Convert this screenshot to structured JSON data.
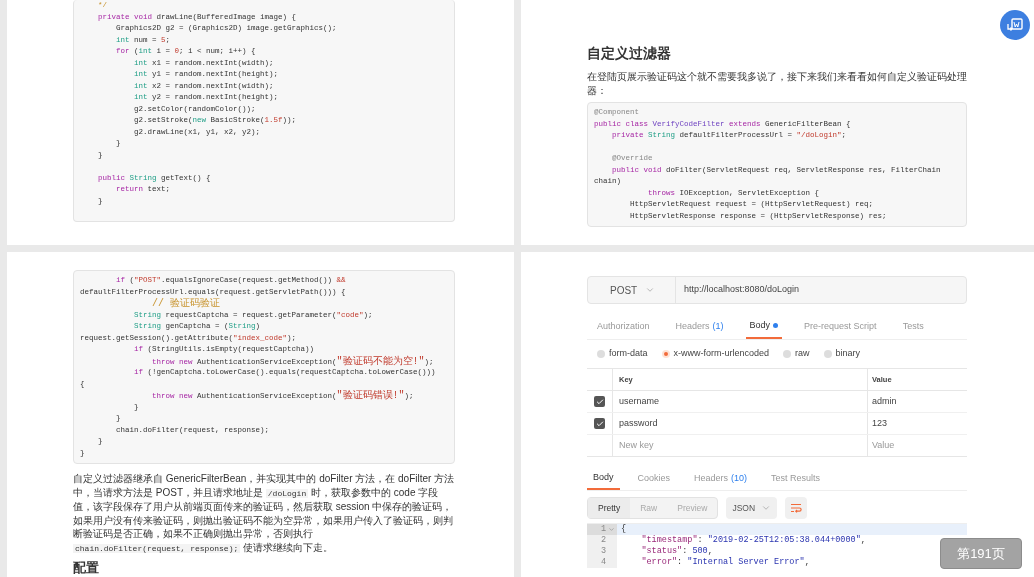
{
  "top_left_page": {
    "code": [
      {
        "kind": "code",
        "tokens": [
          {
            "text": "    */",
            "kind": "cm"
          }
        ]
      },
      {
        "kind": "code",
        "tokens": [
          {
            "text": "    private void",
            "kind": "kw"
          },
          {
            "text": " drawLine(BufferedImage image) {",
            "kind": "plain"
          }
        ]
      },
      {
        "kind": "code",
        "tokens": [
          {
            "text": "        Graphics2D g2 = (Graphics2D) image.getGraphics();",
            "kind": "plain"
          }
        ]
      },
      {
        "kind": "code",
        "tokens": [
          {
            "text": "        int",
            "kind": "ty"
          },
          {
            "text": " num = ",
            "kind": "plain"
          },
          {
            "text": "5",
            "kind": "num"
          },
          {
            "text": ";",
            "kind": "plain"
          }
        ]
      },
      {
        "kind": "code",
        "tokens": [
          {
            "text": "        for",
            "kind": "kw"
          },
          {
            "text": " (",
            "kind": "plain"
          },
          {
            "text": "int",
            "kind": "ty"
          },
          {
            "text": " i = ",
            "kind": "plain"
          },
          {
            "text": "0",
            "kind": "num"
          },
          {
            "text": "; i < num; i++) {",
            "kind": "plain"
          }
        ]
      },
      {
        "kind": "code",
        "tokens": [
          {
            "text": "            int",
            "kind": "ty"
          },
          {
            "text": " x1 = random.nextInt(width);",
            "kind": "plain"
          }
        ]
      },
      {
        "kind": "code",
        "tokens": [
          {
            "text": "            int",
            "kind": "ty"
          },
          {
            "text": " y1 = random.nextInt(height);",
            "kind": "plain"
          }
        ]
      },
      {
        "kind": "code",
        "tokens": [
          {
            "text": "            int",
            "kind": "ty"
          },
          {
            "text": " x2 = random.nextInt(width);",
            "kind": "plain"
          }
        ]
      },
      {
        "kind": "code",
        "tokens": [
          {
            "text": "            int",
            "kind": "ty"
          },
          {
            "text": " y2 = random.nextInt(height);",
            "kind": "plain"
          }
        ]
      },
      {
        "kind": "code",
        "tokens": [
          {
            "text": "            g2.setColor(randomColor());",
            "kind": "plain"
          }
        ]
      },
      {
        "kind": "code",
        "tokens": [
          {
            "text": "            g2.setStroke(",
            "kind": "plain"
          },
          {
            "text": "new",
            "kind": "ty"
          },
          {
            "text": " BasicStroke(",
            "kind": "plain"
          },
          {
            "text": "1.5f",
            "kind": "num"
          },
          {
            "text": "));",
            "kind": "plain"
          }
        ]
      },
      {
        "kind": "code",
        "tokens": [
          {
            "text": "            g2.drawLine(x1, y1, x2, y2);",
            "kind": "plain"
          }
        ]
      },
      {
        "kind": "code",
        "tokens": [
          {
            "text": "        }",
            "kind": "plain"
          }
        ]
      },
      {
        "kind": "code",
        "tokens": [
          {
            "text": "    }",
            "kind": "plain"
          }
        ]
      },
      {
        "kind": "blank"
      },
      {
        "kind": "code",
        "tokens": [
          {
            "text": "    public",
            "kind": "kw"
          },
          {
            "text": " String",
            "kind": "ty"
          },
          {
            "text": " getText() {",
            "kind": "plain"
          }
        ]
      },
      {
        "kind": "code",
        "tokens": [
          {
            "text": "        return",
            "kind": "kw"
          },
          {
            "text": " text;",
            "kind": "plain"
          }
        ]
      },
      {
        "kind": "code",
        "tokens": [
          {
            "text": "    }",
            "kind": "plain"
          }
        ]
      }
    ]
  },
  "top_right_page": {
    "heading": "自定义过滤器",
    "intro": "在登陆页展示验证码这个就不需要我多说了，接下来我们来看看如何自定义验证码处理器：",
    "code": [
      {
        "kind": "code",
        "tokens": [
          {
            "text": "@Component",
            "kind": "an"
          }
        ]
      },
      {
        "kind": "code",
        "tokens": [
          {
            "text": "public class",
            "kind": "kw"
          },
          {
            "text": " VerifyCodeFilter",
            "kind": "cls"
          },
          {
            "text": " extends",
            "kind": "kw"
          },
          {
            "text": " GenericFilterBean {",
            "kind": "plain"
          }
        ]
      },
      {
        "kind": "code",
        "tokens": [
          {
            "text": "    private",
            "kind": "kw"
          },
          {
            "text": " String",
            "kind": "ty"
          },
          {
            "text": " defaultFilterProcessUrl = ",
            "kind": "plain"
          },
          {
            "text": "\"/doLogin\"",
            "kind": "str"
          },
          {
            "text": ";",
            "kind": "plain"
          }
        ]
      },
      {
        "kind": "blank"
      },
      {
        "kind": "code",
        "tokens": [
          {
            "text": "    @Override",
            "kind": "an"
          }
        ]
      },
      {
        "kind": "code",
        "tokens": [
          {
            "text": "    public void",
            "kind": "kw"
          },
          {
            "text": " doFilter(ServletRequest req, ServletResponse res, FilterChain",
            "kind": "plain"
          }
        ]
      },
      {
        "kind": "code",
        "tokens": [
          {
            "text": "chain)",
            "kind": "plain"
          }
        ]
      },
      {
        "kind": "code",
        "tokens": [
          {
            "text": "            throws",
            "kind": "kw"
          },
          {
            "text": " IOException, ServletException {",
            "kind": "plain"
          }
        ]
      },
      {
        "kind": "code",
        "tokens": [
          {
            "text": "        HttpServletRequest request = (HttpServletRequest) req;",
            "kind": "plain"
          }
        ]
      },
      {
        "kind": "code",
        "tokens": [
          {
            "text": "        HttpServletResponse response = (HttpServletResponse) res;",
            "kind": "plain"
          }
        ]
      }
    ]
  },
  "bottom_left_page": {
    "code": [
      {
        "kind": "code",
        "tokens": [
          {
            "text": "        if",
            "kind": "kw"
          },
          {
            "text": " (",
            "kind": "plain"
          },
          {
            "text": "\"POST\"",
            "kind": "str"
          },
          {
            "text": ".equalsIgnoreCase(request.getMethod()) ",
            "kind": "plain"
          },
          {
            "text": "&&",
            "kind": "str"
          }
        ]
      },
      {
        "kind": "code",
        "tokens": [
          {
            "text": "defaultFilterProcessUrl.equals(request.getServletPath())) {",
            "kind": "plain"
          }
        ]
      },
      {
        "kind": "code",
        "tokens": [
          {
            "text": "            // 验证码验证",
            "kind": "cmzh"
          }
        ]
      },
      {
        "kind": "code",
        "tokens": [
          {
            "text": "            String",
            "kind": "ty"
          },
          {
            "text": " requestCaptcha = request.getParameter(",
            "kind": "plain"
          },
          {
            "text": "\"code\"",
            "kind": "str"
          },
          {
            "text": ");",
            "kind": "plain"
          }
        ]
      },
      {
        "kind": "code",
        "tokens": [
          {
            "text": "            String",
            "kind": "ty"
          },
          {
            "text": " genCaptcha = (",
            "kind": "plain"
          },
          {
            "text": "String",
            "kind": "ty"
          },
          {
            "text": ")",
            "kind": "plain"
          }
        ]
      },
      {
        "kind": "code",
        "tokens": [
          {
            "text": "request.getSession().getAttribute(",
            "kind": "plain"
          },
          {
            "text": "\"index_code\"",
            "kind": "str"
          },
          {
            "text": ");",
            "kind": "plain"
          }
        ]
      },
      {
        "kind": "code",
        "tokens": [
          {
            "text": "            if",
            "kind": "kw"
          },
          {
            "text": " (StringUtils.isEmpty(requestCaptcha))",
            "kind": "plain"
          }
        ]
      },
      {
        "kind": "code",
        "tokens": [
          {
            "text": "                throw new",
            "kind": "kw"
          },
          {
            "text": " AuthenticationServiceException(",
            "kind": "plain"
          },
          {
            "text": "\"验证码不能为空!\"",
            "kind": "strzh"
          },
          {
            "text": ");",
            "kind": "plain"
          }
        ]
      },
      {
        "kind": "code",
        "tokens": [
          {
            "text": "            if",
            "kind": "kw"
          },
          {
            "text": " (!genCaptcha.toLowerCase().equals(requestCaptcha.toLowerCase()))",
            "kind": "plain"
          }
        ]
      },
      {
        "kind": "code",
        "tokens": [
          {
            "text": "{",
            "kind": "plain"
          }
        ]
      },
      {
        "kind": "code",
        "tokens": [
          {
            "text": "                throw new",
            "kind": "kw"
          },
          {
            "text": " AuthenticationServiceException(",
            "kind": "plain"
          },
          {
            "text": "\"验证码错误!\"",
            "kind": "strzh"
          },
          {
            "text": ");",
            "kind": "plain"
          }
        ]
      },
      {
        "kind": "code",
        "tokens": [
          {
            "text": "            }",
            "kind": "plain"
          }
        ]
      },
      {
        "kind": "code",
        "tokens": [
          {
            "text": "        }",
            "kind": "plain"
          }
        ]
      },
      {
        "kind": "code",
        "tokens": [
          {
            "text": "        chain.doFilter(request, response);",
            "kind": "plain"
          }
        ]
      },
      {
        "kind": "code",
        "tokens": [
          {
            "text": "    }",
            "kind": "plain"
          }
        ]
      },
      {
        "kind": "code",
        "tokens": [
          {
            "text": "}",
            "kind": "plain"
          }
        ]
      }
    ],
    "paragraph": [
      {
        "text": "自定义过滤器继承自 GenericFilterBean，并实现其中的 doFilter 方法，在 doFilter 方法中，当请求方法是 POST，并且请求地址是 ",
        "code": false
      },
      {
        "text": "/doLogin",
        "code": true
      },
      {
        "text": " 时，获取参数中的 code 字段值，该字段保存了用户从前端页面传来的验证码，然后获取 session 中保存的验证码，如果用户没有传来验证码，则抛出验证码不能为空异常，如果用户传入了验证码，则判断验证码是否正确，如果不正确则抛出异常，否则执行 ",
        "code": false
      },
      {
        "text": "chain.doFilter(request, response);",
        "code": true
      },
      {
        "text": " 使请求继续向下走。",
        "code": false
      }
    ],
    "heading": "配置"
  },
  "bottom_right_page": {
    "request": {
      "method": "POST",
      "url": "http://localhost:8080/doLogin",
      "tabs": [
        {
          "label": "Authorization",
          "dot": false,
          "selected": false
        },
        {
          "label": "Headers",
          "count": "(1)",
          "dot": false,
          "selected": false
        },
        {
          "label": "Body",
          "dot": true,
          "selected": true
        },
        {
          "label": "Pre-request Script",
          "dot": false,
          "selected": false
        },
        {
          "label": "Tests",
          "dot": false,
          "selected": false
        }
      ],
      "body_types": [
        {
          "label": "form-data",
          "selected": false
        },
        {
          "label": "x-www-form-urlencoded",
          "selected": true
        },
        {
          "label": "raw",
          "selected": false
        },
        {
          "label": "binary",
          "selected": false
        }
      ],
      "columns": [
        "Key",
        "Value"
      ],
      "rows": [
        {
          "key": "username",
          "value": "admin",
          "checked": true
        },
        {
          "key": "password",
          "value": "123",
          "checked": true
        }
      ],
      "new_row": {
        "key_placeholder": "New key",
        "value_placeholder": "Value"
      }
    },
    "response": {
      "tabs": [
        {
          "label": "Body",
          "selected": true
        },
        {
          "label": "Cookies",
          "selected": false
        },
        {
          "label": "Headers",
          "count": "(10)",
          "selected": false
        },
        {
          "label": "Test Results",
          "selected": false
        }
      ],
      "views": [
        {
          "label": "Pretty",
          "selected": true
        },
        {
          "label": "Raw",
          "selected": false
        },
        {
          "label": "Preview",
          "selected": false
        }
      ],
      "format": "JSON",
      "lines": [
        {
          "number": "1",
          "active": true,
          "foldable": true,
          "tokens": [
            {
              "text": "{",
              "kind": "punc"
            }
          ]
        },
        {
          "number": "2",
          "active": false,
          "foldable": false,
          "tokens": [
            {
              "text": "    \"timestamp\"",
              "kind": "key"
            },
            {
              "text": ": ",
              "kind": "punc"
            },
            {
              "text": "\"2019-02-25T12:05:38.044+0000\"",
              "kind": "str"
            },
            {
              "text": ",",
              "kind": "punc"
            }
          ]
        },
        {
          "number": "3",
          "active": false,
          "foldable": false,
          "tokens": [
            {
              "text": "    \"status\"",
              "kind": "key"
            },
            {
              "text": ": ",
              "kind": "punc"
            },
            {
              "text": "500",
              "kind": "num"
            },
            {
              "text": ",",
              "kind": "punc"
            }
          ]
        },
        {
          "number": "4",
          "active": false,
          "foldable": false,
          "tokens": [
            {
              "text": "    \"error\"",
              "kind": "key"
            },
            {
              "text": ": ",
              "kind": "punc"
            },
            {
              "text": "\"Internal Server Error\"",
              "kind": "str"
            },
            {
              "text": ",",
              "kind": "punc"
            }
          ]
        }
      ]
    }
  },
  "page_indicator": "第191页"
}
